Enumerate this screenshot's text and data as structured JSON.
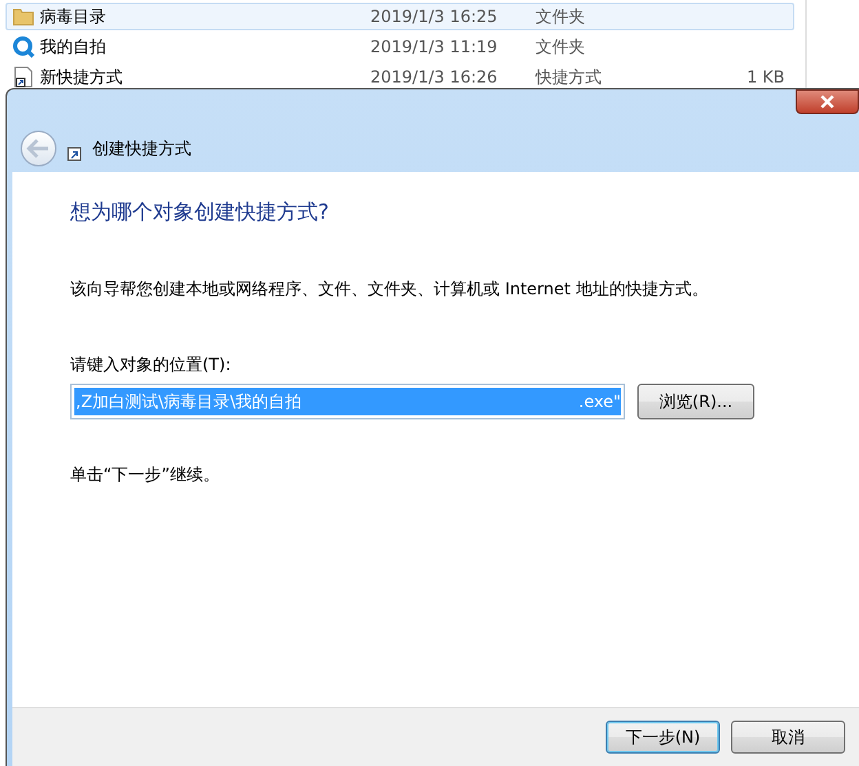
{
  "file_list": [
    {
      "kind": "folder",
      "name": "病毒目录",
      "date": "2019/1/3 16:25",
      "type": "文件夹",
      "selected": true
    },
    {
      "kind": "app",
      "name": "我的自拍",
      "date": "2019/1/3 11:19",
      "type": "文件夹",
      "selected": false
    },
    {
      "kind": "shortcut",
      "name": "新快捷方式",
      "date": "2019/1/3 16:26",
      "type": "快捷方式",
      "size": "1 KB",
      "selected": false
    }
  ],
  "dialog": {
    "title": "创建快捷方式",
    "heading": "想为哪个对象创建快捷方式?",
    "description": "该向导帮您创建本地或网络程序、文件、文件夹、计算机或 Internet 地址的快捷方式。",
    "location_label": "请键入对象的位置(T):",
    "location_value_start": ",Z加白测试\\病毒目录\\我的自拍",
    "location_value_end": ".exe\"",
    "browse_button": "浏览(R)...",
    "hint": "单击“下一步”继续。",
    "buttons": [
      {
        "label": "下一步(N)",
        "default": true
      },
      {
        "label": "取消",
        "default": false
      }
    ]
  }
}
